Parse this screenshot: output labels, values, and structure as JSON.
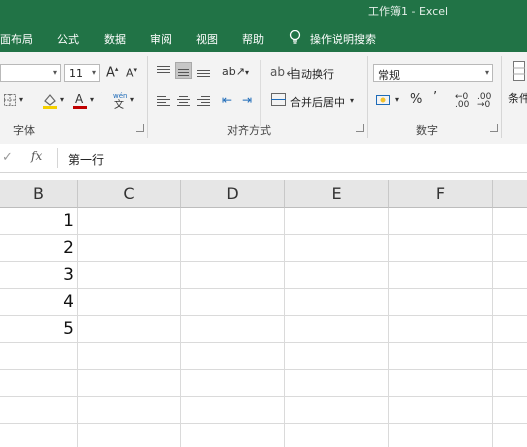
{
  "window": {
    "title": "工作簿1  -  Excel"
  },
  "menu": {
    "items": [
      "面布局",
      "公式",
      "数据",
      "审阅",
      "视图",
      "帮助"
    ],
    "tell_me": "操作说明搜索"
  },
  "ribbon": {
    "font_size": "11",
    "font_group": "字体",
    "alignment": {
      "wrap_text": "自动换行",
      "merge_center": "合并后居中",
      "group": "对齐方式"
    },
    "number": {
      "format": "常规",
      "percent": "%",
      "comma": "’",
      "group": "数字"
    },
    "styles_partial": "条件"
  },
  "formula_bar": {
    "fx": "fx",
    "value": "第一行"
  },
  "columns": [
    "B",
    "C",
    "D",
    "E",
    "F"
  ],
  "cells_B": [
    "1",
    "2",
    "3",
    "4",
    "5"
  ]
}
